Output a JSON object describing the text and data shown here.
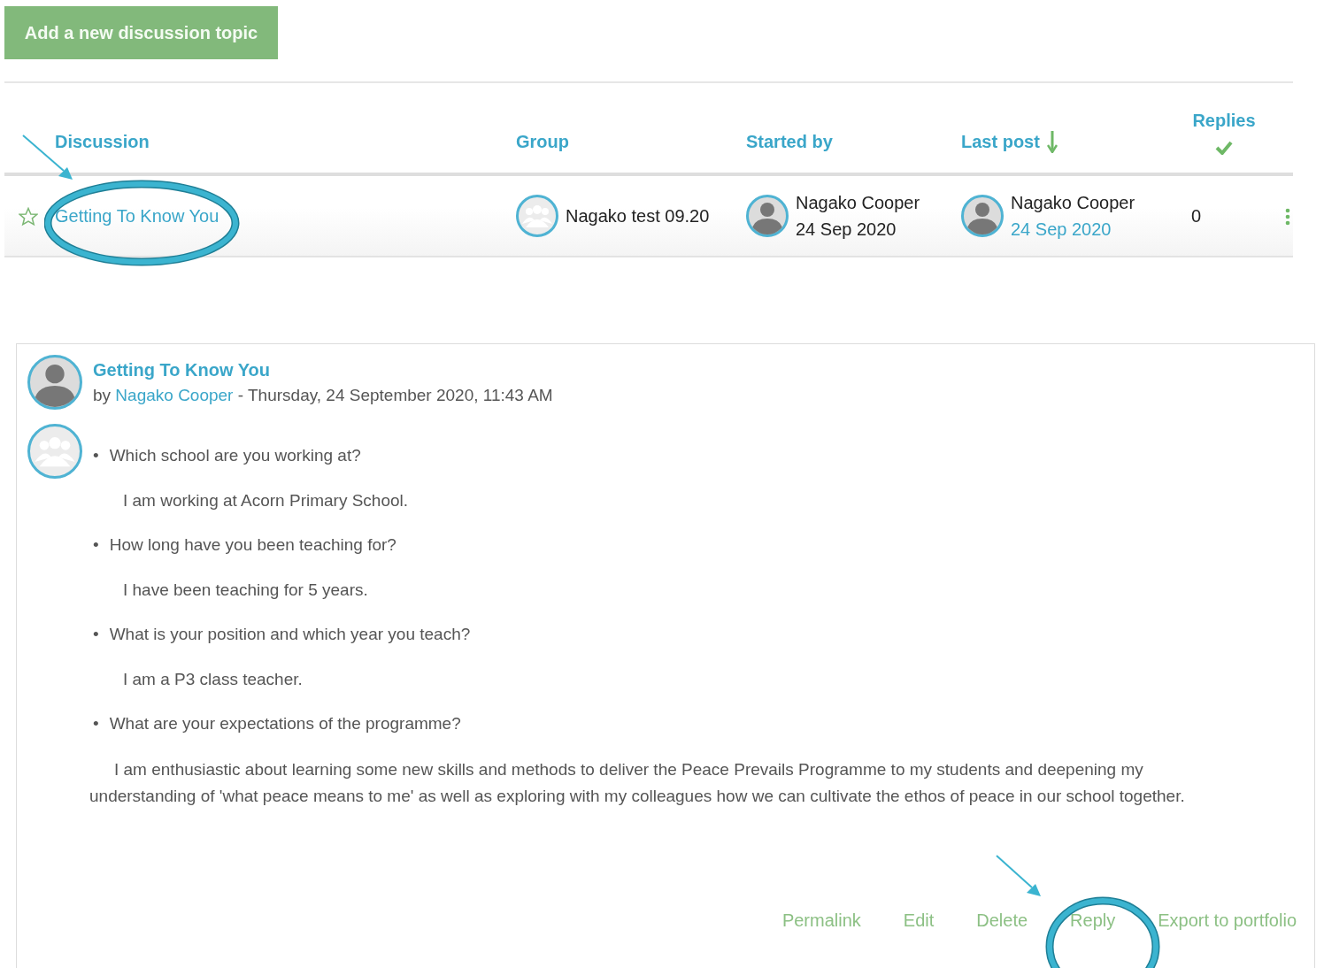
{
  "add_button": "Add a new discussion topic",
  "table": {
    "columns": [
      {
        "label": "Discussion",
        "sorted": false
      },
      {
        "label": "Group",
        "sorted": false
      },
      {
        "label": "Started by",
        "sorted": false
      },
      {
        "label": "Last post",
        "sorted": true
      },
      {
        "label": "Replies",
        "sorted": false
      }
    ],
    "rows": [
      {
        "starred": false,
        "discussion": "Getting To Know You",
        "group": "Nagako test 09.20",
        "started_by": {
          "name": "Nagako Cooper",
          "date": "24 Sep 2020"
        },
        "last_post": {
          "name": "Nagako Cooper",
          "date": "24 Sep 2020"
        },
        "replies": "0"
      }
    ]
  },
  "post": {
    "title": "Getting To Know You",
    "by": "by",
    "author": "Nagako Cooper",
    "date": " - Thursday, 24 September 2020, 11:43 AM",
    "body": [
      {
        "kind": "question",
        "bullet": "•",
        "text": "Which school are you working at?"
      },
      {
        "kind": "answer",
        "text": "I am working at Acorn Primary School."
      },
      {
        "kind": "question",
        "bullet": "•",
        "text": "How long have you been teaching for?"
      },
      {
        "kind": "answer",
        "text": "I have been teaching for 5 years."
      },
      {
        "kind": "question",
        "bullet": "•",
        "text": "What is your position and which year you teach?"
      },
      {
        "kind": "answer",
        "text": "I am a P3 class teacher."
      },
      {
        "kind": "question",
        "bullet": "•",
        "text": "What are your expectations of the programme?"
      },
      {
        "kind": "paragraph",
        "text": "I am enthusiastic about learning some new skills and methods to deliver the Peace Prevails Programme to my students and deepening my understanding of 'what peace means to me' as well as exploring with my colleagues how we can cultivate the ethos of peace in our school together."
      }
    ],
    "actions": [
      "Permalink",
      "Edit",
      "Delete",
      "Reply",
      "Export to portfolio"
    ]
  }
}
